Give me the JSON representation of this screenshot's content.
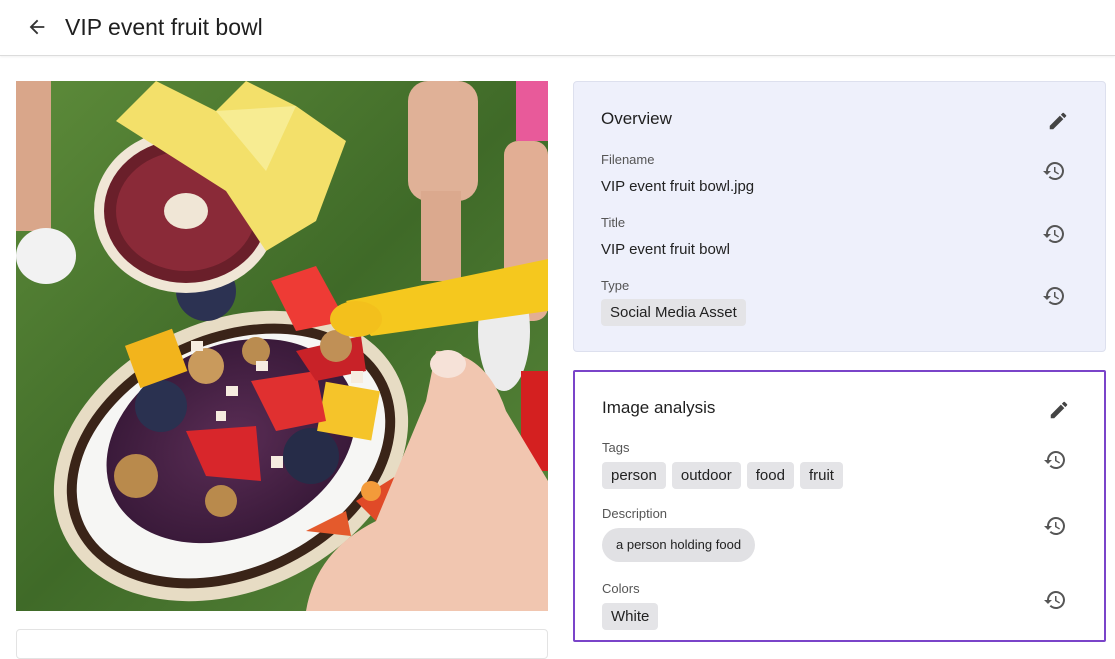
{
  "header": {
    "title": "VIP event fruit bowl",
    "back_icon": "arrow-left-icon"
  },
  "image": {
    "subject": "photo"
  },
  "overview": {
    "title": "Overview",
    "edit_icon": "pencil-icon",
    "fields": {
      "filename": {
        "label": "Filename",
        "value": "VIP event fruit bowl.jpg"
      },
      "title": {
        "label": "Title",
        "value": "VIP event fruit bowl"
      },
      "type": {
        "label": "Type",
        "value": "Social Media Asset"
      }
    },
    "history_icon": "history-icon"
  },
  "image_analysis": {
    "title": "Image analysis",
    "edit_icon": "pencil-icon",
    "tags": {
      "label": "Tags",
      "values": [
        "person",
        "outdoor",
        "food",
        "fruit"
      ]
    },
    "description": {
      "label": "Description",
      "value": "a person holding food"
    },
    "colors": {
      "label": "Colors",
      "values": [
        "White"
      ]
    },
    "highlight_color": "#7a44c9"
  },
  "colors": {
    "overview_bg": "#eef0fb",
    "chip_bg": "#e4e4e7"
  }
}
